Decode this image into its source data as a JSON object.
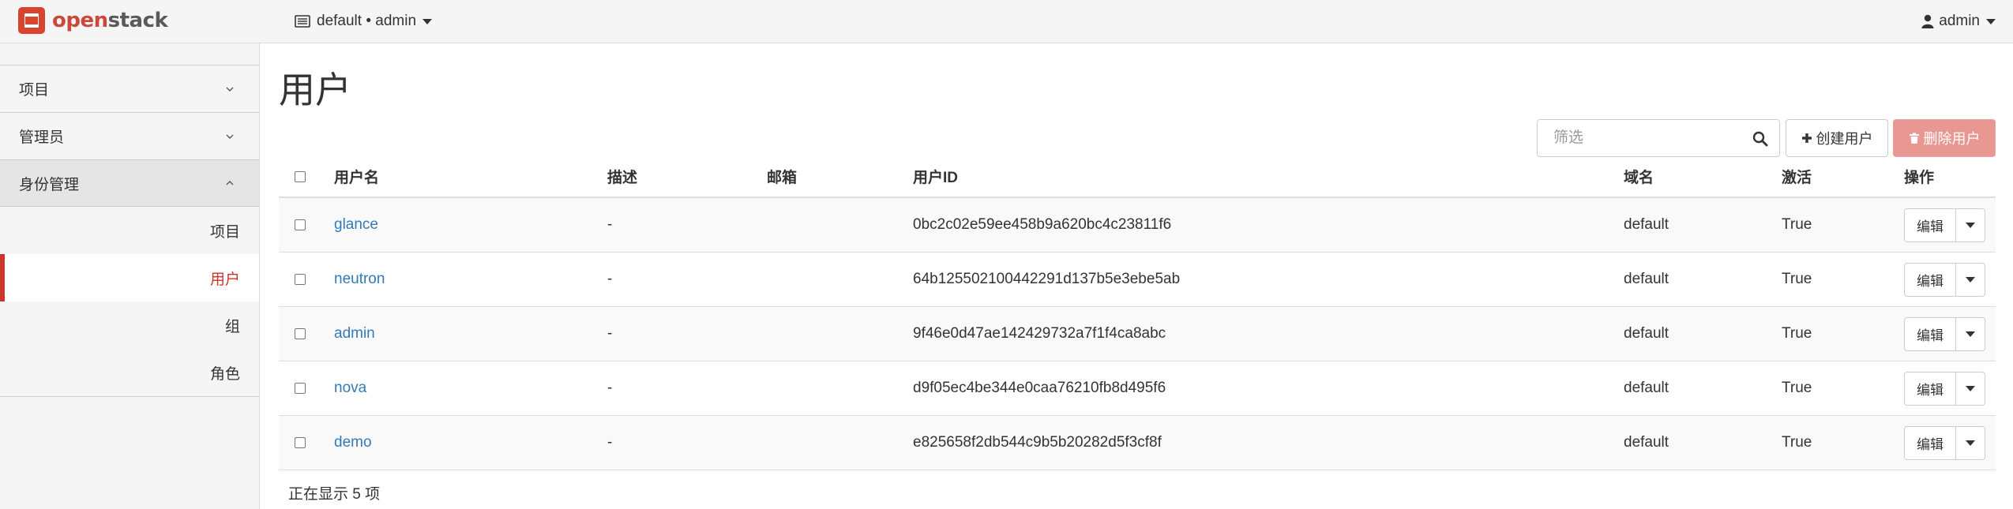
{
  "brand": {
    "open": "open",
    "stack": "stack"
  },
  "topbar": {
    "project_context": "default • admin",
    "user": "admin"
  },
  "sidebar": {
    "groups": [
      {
        "label": "项目",
        "expanded": false
      },
      {
        "label": "管理员",
        "expanded": false
      },
      {
        "label": "身份管理",
        "expanded": true,
        "items": [
          "项目",
          "用户",
          "组",
          "角色"
        ],
        "active_item": "用户"
      }
    ]
  },
  "page": {
    "title": "用户",
    "filter_placeholder": "筛选",
    "create_button": "创建用户",
    "delete_button": "删除用户",
    "footer": "正在显示 5 项"
  },
  "table": {
    "columns": [
      "用户名",
      "描述",
      "邮箱",
      "用户ID",
      "域名",
      "激活",
      "操作"
    ],
    "edit_label": "编辑",
    "rows": [
      {
        "name": "glance",
        "description": "-",
        "email": "",
        "id": "0bc2c02e59ee458b9a620bc4c23811f6",
        "domain": "default",
        "enabled": "True"
      },
      {
        "name": "neutron",
        "description": "-",
        "email": "",
        "id": "64b125502100442291d137b5e3ebe5ab",
        "domain": "default",
        "enabled": "True"
      },
      {
        "name": "admin",
        "description": "-",
        "email": "",
        "id": "9f46e0d47ae142429732a7f1f4ca8abc",
        "domain": "default",
        "enabled": "True"
      },
      {
        "name": "nova",
        "description": "-",
        "email": "",
        "id": "d9f05ec4be344e0caa76210fb8d495f6",
        "domain": "default",
        "enabled": "True"
      },
      {
        "name": "demo",
        "description": "-",
        "email": "",
        "id": "e825658f2db544c9b5b20282d5f3cf8f",
        "domain": "default",
        "enabled": "True"
      }
    ]
  },
  "colors": {
    "accent": "#c9372c",
    "link": "#337ab7",
    "danger_button": "#e89792"
  },
  "icons": [
    "openstack-logo-icon",
    "project-context-icon",
    "user-icon",
    "chevron-down-icon",
    "chevron-up-icon",
    "search-icon",
    "plus-icon",
    "trash-icon",
    "caret-down-icon"
  ]
}
